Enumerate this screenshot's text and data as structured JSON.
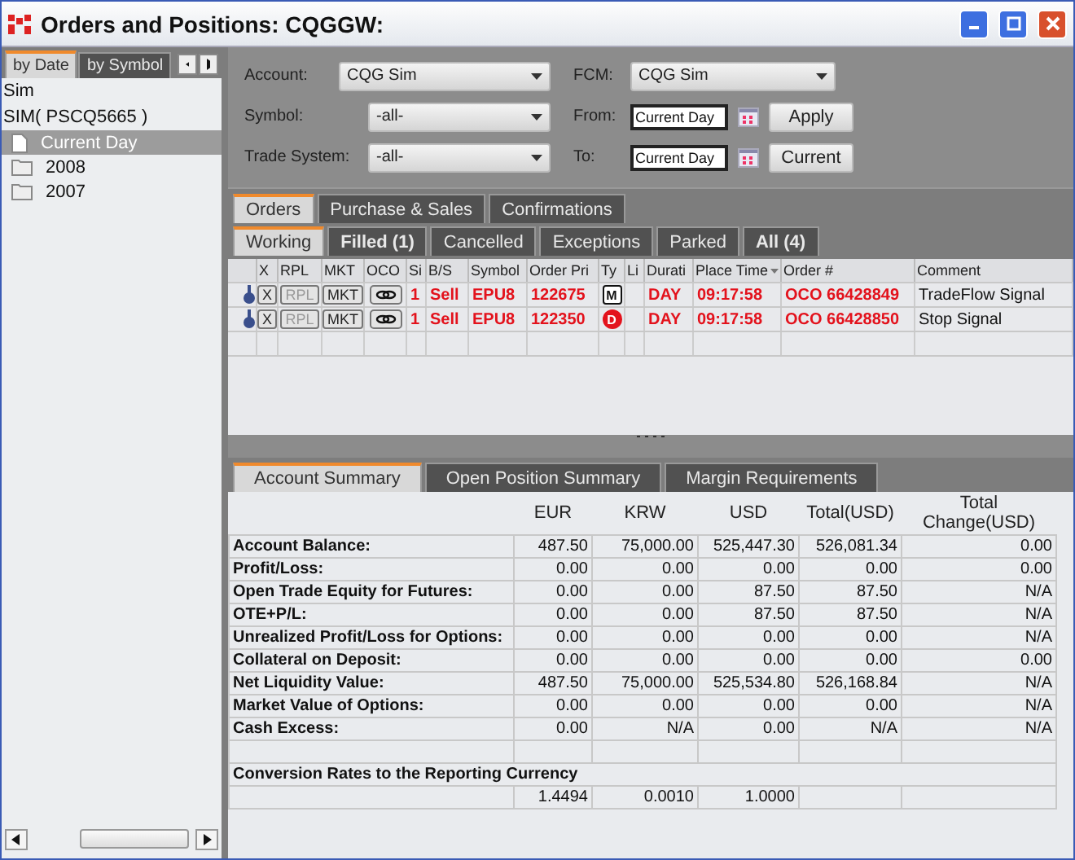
{
  "window": {
    "title": "Orders and Positions: CQGGW:"
  },
  "left": {
    "tabs": [
      {
        "label": "by Date",
        "selected": true
      },
      {
        "label": "by Symbol",
        "selected": false
      }
    ],
    "header_lines": [
      "Sim",
      "SIM( PSCQ5665 )"
    ],
    "items": [
      {
        "label": "Current Day",
        "kind": "file",
        "selected": true
      },
      {
        "label": "2008",
        "kind": "folder",
        "selected": false
      },
      {
        "label": "2007",
        "kind": "folder",
        "selected": false
      }
    ]
  },
  "filters": {
    "left": [
      {
        "label": "Account:",
        "value": "CQG Sim",
        "wide": true
      },
      {
        "label": "Symbol:",
        "value": "-all-",
        "wide": false
      },
      {
        "label": "Trade System:",
        "value": "-all-",
        "wide": false
      }
    ],
    "fcm": {
      "label": "FCM:",
      "value": "CQG Sim"
    },
    "dates": [
      {
        "label": "From:",
        "value": "Current Day",
        "button": "Apply"
      },
      {
        "label": "To:",
        "value": "Current Day",
        "button": "Current"
      }
    ]
  },
  "order_tabs": [
    {
      "label": "Orders",
      "selected": true
    },
    {
      "label": "Purchase & Sales",
      "selected": false
    },
    {
      "label": "Confirmations",
      "selected": false
    }
  ],
  "status_tabs": [
    {
      "label": "Working",
      "selected": true,
      "bold": false
    },
    {
      "label": "Filled (1)",
      "selected": false,
      "bold": true
    },
    {
      "label": "Cancelled",
      "selected": false,
      "bold": false
    },
    {
      "label": "Exceptions",
      "selected": false,
      "bold": false
    },
    {
      "label": "Parked",
      "selected": false,
      "bold": false
    },
    {
      "label": "All (4)",
      "selected": false,
      "bold": true
    }
  ],
  "orders": {
    "columns": [
      "",
      "X",
      "RPL",
      "MKT",
      "OCO",
      "Si",
      "B/S",
      "Symbol",
      "Order Pri",
      "Ty",
      "Li",
      "Durati",
      "Place Time",
      "Order #",
      "Comment"
    ],
    "rows": [
      {
        "cancel": "X",
        "replace": "RPL",
        "market": "MKT",
        "side_qty": "1",
        "side": "Sell",
        "symbol": "EPU8",
        "price": "122675",
        "type": {
          "label": "M",
          "kind": "box"
        },
        "duration": "DAY",
        "time": "09:17:58",
        "order": "OCO 66428849",
        "comment": "TradeFlow Signal"
      },
      {
        "cancel": "X",
        "replace": "RPL",
        "market": "MKT",
        "side_qty": "1",
        "side": "Sell",
        "symbol": "EPU8",
        "price": "122350",
        "type": {
          "label": "D",
          "kind": "circle"
        },
        "duration": "DAY",
        "time": "09:17:58",
        "order": "OCO 66428850",
        "comment": "Stop Signal"
      }
    ]
  },
  "summary_tabs": [
    {
      "label": "Account Summary",
      "selected": true
    },
    {
      "label": "Open Position Summary",
      "selected": false
    },
    {
      "label": "Margin Requirements",
      "selected": false
    }
  ],
  "summary": {
    "columns": [
      "EUR",
      "KRW",
      "USD",
      "Total(USD)",
      "Total Change(USD)"
    ],
    "rows": [
      {
        "label": "Account Balance:",
        "values": [
          "487.50",
          "75,000.00",
          "525,447.30",
          "526,081.34",
          "0.00"
        ]
      },
      {
        "label": "Profit/Loss:",
        "values": [
          "0.00",
          "0.00",
          "0.00",
          "0.00",
          "0.00"
        ]
      },
      {
        "label": "Open Trade Equity for Futures:",
        "values": [
          "0.00",
          "0.00",
          "87.50",
          "87.50",
          "N/A"
        ]
      },
      {
        "label": "OTE+P/L:",
        "values": [
          "0.00",
          "0.00",
          "87.50",
          "87.50",
          "N/A"
        ]
      },
      {
        "label": "Unrealized Profit/Loss for Options:",
        "values": [
          "0.00",
          "0.00",
          "0.00",
          "0.00",
          "N/A"
        ]
      },
      {
        "label": "Collateral on Deposit:",
        "values": [
          "0.00",
          "0.00",
          "0.00",
          "0.00",
          "0.00"
        ]
      },
      {
        "label": "Net Liquidity Value:",
        "values": [
          "487.50",
          "75,000.00",
          "525,534.80",
          "526,168.84",
          "N/A"
        ]
      },
      {
        "label": "Market Value of Options:",
        "values": [
          "0.00",
          "0.00",
          "0.00",
          "0.00",
          "N/A"
        ]
      },
      {
        "label": "Cash Excess:",
        "values": [
          "0.00",
          "N/A",
          "0.00",
          "N/A",
          "N/A"
        ]
      }
    ],
    "conversion": {
      "title": "Conversion Rates to the Reporting Currency",
      "values": [
        "1.4494",
        "0.0010",
        "1.0000"
      ]
    }
  }
}
